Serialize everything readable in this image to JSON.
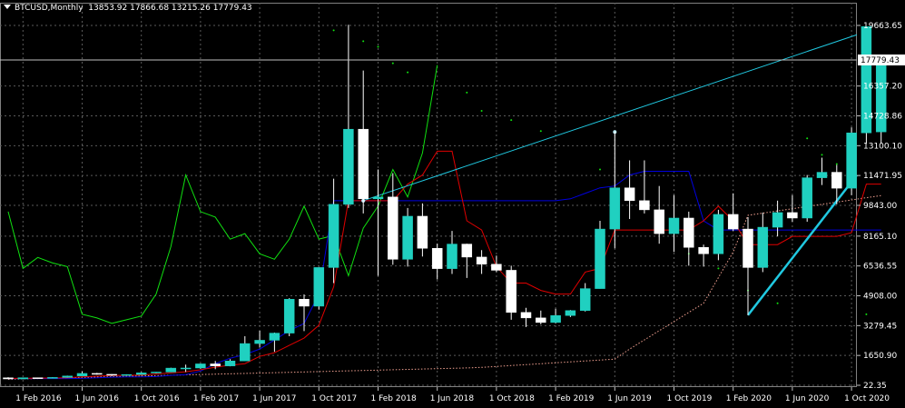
{
  "header": {
    "symbol": "BTCUSD,Monthly",
    "ohlc": "13853.92 17866.68 13215.26 17779.43"
  },
  "price_scale": {
    "labels": [
      "19663.65",
      "16357.20",
      "14728.86",
      "13100.10",
      "11471.95",
      "9843.00",
      "8165.10",
      "6536.55",
      "4908.00",
      "3279.45",
      "1650.90",
      "22.35"
    ],
    "current_price_label": "17779.43"
  },
  "time_scale": {
    "labels": [
      "1 Feb 2016",
      "1 Jun 2016",
      "1 Oct 2016",
      "1 Feb 2017",
      "1 Jun 2017",
      "1 Oct 2017",
      "1 Feb 2018",
      "1 Jun 2018",
      "1 Oct 2018",
      "1 Feb 2019",
      "1 Jun 2019",
      "1 Oct 2019",
      "1 Feb 2020",
      "1 Jun 2020",
      "1 Oct 2020"
    ]
  },
  "colors": {
    "background": "#000000",
    "grid": "#5a5a5a",
    "bull": "#20d0c0",
    "bear": "#ffffff",
    "wick": "#ffffff",
    "ma_red": "#e00000",
    "ma_blue": "#0000e0",
    "chikou_green": "#10e010",
    "dots": "#10e010",
    "trend": "#20c8e0",
    "cloud_dash": "#f0a090"
  },
  "chart_data": {
    "type": "candlestick",
    "timeframe": "Monthly",
    "ylim": [
      22.35,
      21000
    ],
    "candles": [
      {
        "x": "2016-01",
        "o": 430,
        "h": 460,
        "l": 360,
        "c": 370
      },
      {
        "x": "2016-02",
        "o": 370,
        "h": 440,
        "l": 355,
        "c": 435
      },
      {
        "x": "2016-03",
        "o": 435,
        "h": 440,
        "l": 400,
        "c": 415
      },
      {
        "x": "2016-04",
        "o": 415,
        "h": 470,
        "l": 410,
        "c": 450
      },
      {
        "x": "2016-05",
        "o": 450,
        "h": 550,
        "l": 440,
        "c": 530
      },
      {
        "x": "2016-06",
        "o": 530,
        "h": 780,
        "l": 520,
        "c": 670
      },
      {
        "x": "2016-07",
        "o": 670,
        "h": 700,
        "l": 600,
        "c": 620
      },
      {
        "x": "2016-08",
        "o": 620,
        "h": 630,
        "l": 530,
        "c": 575
      },
      {
        "x": "2016-09",
        "o": 575,
        "h": 620,
        "l": 590,
        "c": 610
      },
      {
        "x": "2016-10",
        "o": 610,
        "h": 740,
        "l": 600,
        "c": 700
      },
      {
        "x": "2016-11",
        "o": 700,
        "h": 750,
        "l": 680,
        "c": 745
      },
      {
        "x": "2016-12",
        "o": 745,
        "h": 980,
        "l": 740,
        "c": 960
      },
      {
        "x": "2017-01",
        "o": 960,
        "h": 1150,
        "l": 750,
        "c": 965
      },
      {
        "x": "2017-02",
        "o": 965,
        "h": 1210,
        "l": 920,
        "c": 1190
      },
      {
        "x": "2017-03",
        "o": 1190,
        "h": 1350,
        "l": 900,
        "c": 1080
      },
      {
        "x": "2017-04",
        "o": 1080,
        "h": 1450,
        "l": 1060,
        "c": 1350
      },
      {
        "x": "2017-05",
        "o": 1350,
        "h": 2700,
        "l": 1340,
        "c": 2300
      },
      {
        "x": "2017-06",
        "o": 2300,
        "h": 3000,
        "l": 2080,
        "c": 2480
      },
      {
        "x": "2017-07",
        "o": 2480,
        "h": 2900,
        "l": 1850,
        "c": 2870
      },
      {
        "x": "2017-08",
        "o": 2870,
        "h": 4780,
        "l": 2700,
        "c": 4720
      },
      {
        "x": "2017-09",
        "o": 4720,
        "h": 4980,
        "l": 2980,
        "c": 4340
      },
      {
        "x": "2017-10",
        "o": 4340,
        "h": 6450,
        "l": 4150,
        "c": 6450
      },
      {
        "x": "2017-11",
        "o": 6450,
        "h": 11300,
        "l": 5600,
        "c": 9900
      },
      {
        "x": "2017-12",
        "o": 9900,
        "h": 19700,
        "l": 9700,
        "c": 14000
      },
      {
        "x": "2018-01",
        "o": 14000,
        "h": 17200,
        "l": 9400,
        "c": 10200
      },
      {
        "x": "2018-02",
        "o": 10200,
        "h": 11800,
        "l": 6000,
        "c": 10300
      },
      {
        "x": "2018-03",
        "o": 10300,
        "h": 11600,
        "l": 6600,
        "c": 6900
      },
      {
        "x": "2018-04",
        "o": 6900,
        "h": 9700,
        "l": 6500,
        "c": 9250
      },
      {
        "x": "2018-05",
        "o": 9250,
        "h": 9950,
        "l": 7050,
        "c": 7500
      },
      {
        "x": "2018-06",
        "o": 7500,
        "h": 7750,
        "l": 5800,
        "c": 6390
      },
      {
        "x": "2018-07",
        "o": 6390,
        "h": 8450,
        "l": 6100,
        "c": 7730
      },
      {
        "x": "2018-08",
        "o": 7730,
        "h": 7750,
        "l": 5880,
        "c": 7020
      },
      {
        "x": "2018-09",
        "o": 7020,
        "h": 7400,
        "l": 6100,
        "c": 6630
      },
      {
        "x": "2018-10",
        "o": 6630,
        "h": 7100,
        "l": 6200,
        "c": 6300
      },
      {
        "x": "2018-11",
        "o": 6300,
        "h": 6550,
        "l": 3600,
        "c": 4000
      },
      {
        "x": "2018-12",
        "o": 4000,
        "h": 4250,
        "l": 3200,
        "c": 3700
      },
      {
        "x": "2019-01",
        "o": 3700,
        "h": 4100,
        "l": 3350,
        "c": 3450
      },
      {
        "x": "2019-02",
        "o": 3450,
        "h": 4200,
        "l": 3400,
        "c": 3830
      },
      {
        "x": "2019-03",
        "o": 3830,
        "h": 4130,
        "l": 3750,
        "c": 4100
      },
      {
        "x": "2019-04",
        "o": 4100,
        "h": 5600,
        "l": 4050,
        "c": 5300
      },
      {
        "x": "2019-05",
        "o": 5300,
        "h": 9000,
        "l": 5300,
        "c": 8550
      },
      {
        "x": "2019-06",
        "o": 8550,
        "h": 13850,
        "l": 7500,
        "c": 10800
      },
      {
        "x": "2019-07",
        "o": 10800,
        "h": 12300,
        "l": 9100,
        "c": 10100
      },
      {
        "x": "2019-08",
        "o": 10100,
        "h": 12300,
        "l": 9400,
        "c": 9600
      },
      {
        "x": "2019-09",
        "o": 9600,
        "h": 10900,
        "l": 7750,
        "c": 8300
      },
      {
        "x": "2019-10",
        "o": 8300,
        "h": 10400,
        "l": 7300,
        "c": 9150
      },
      {
        "x": "2019-11",
        "o": 9150,
        "h": 9500,
        "l": 6550,
        "c": 7550
      },
      {
        "x": "2019-12",
        "o": 7550,
        "h": 7700,
        "l": 6500,
        "c": 7200
      },
      {
        "x": "2020-01",
        "o": 7200,
        "h": 9600,
        "l": 6850,
        "c": 9350
      },
      {
        "x": "2020-02",
        "o": 9350,
        "h": 10500,
        "l": 8450,
        "c": 8550
      },
      {
        "x": "2020-03",
        "o": 8550,
        "h": 9200,
        "l": 3850,
        "c": 6450
      },
      {
        "x": "2020-04",
        "o": 6450,
        "h": 9450,
        "l": 6200,
        "c": 8650
      },
      {
        "x": "2020-05",
        "o": 8650,
        "h": 10100,
        "l": 8150,
        "c": 9450
      },
      {
        "x": "2020-06",
        "o": 9450,
        "h": 10400,
        "l": 8950,
        "c": 9150
      },
      {
        "x": "2020-07",
        "o": 9150,
        "h": 11500,
        "l": 8950,
        "c": 11350
      },
      {
        "x": "2020-08",
        "o": 11350,
        "h": 12450,
        "l": 10950,
        "c": 11650
      },
      {
        "x": "2020-09",
        "o": 11650,
        "h": 12050,
        "l": 9900,
        "c": 10780
      },
      {
        "x": "2020-10",
        "o": 10780,
        "h": 14100,
        "l": 10400,
        "c": 13800
      },
      {
        "x": "2020-11",
        "o": 13800,
        "h": 19500,
        "l": 13200,
        "c": 19600
      },
      {
        "x": "2020-12",
        "o": 13853.92,
        "h": 17866.68,
        "l": 13215.26,
        "c": 17779.43
      }
    ],
    "indicators": {
      "red_line": [
        400,
        400,
        410,
        420,
        430,
        480,
        520,
        560,
        560,
        580,
        640,
        700,
        760,
        870,
        1010,
        1120,
        1200,
        1600,
        1800,
        2200,
        2600,
        3300,
        5400,
        10100,
        10100,
        10100,
        10100,
        11000,
        11500,
        12800,
        12800,
        9000,
        8500,
        6500,
        5600,
        5600,
        5200,
        5000,
        5000,
        6200,
        6400,
        8500,
        8500,
        8500,
        8500,
        8500,
        8500,
        9000,
        9800,
        9000,
        7700,
        7700,
        7700,
        8150,
        8150,
        8150,
        8150,
        8350,
        11000,
        11000
      ],
      "blue_line": [
        390,
        390,
        390,
        390,
        390,
        400,
        430,
        460,
        480,
        480,
        500,
        560,
        600,
        800,
        1200,
        1500,
        1700,
        2000,
        2500,
        3000,
        3400,
        5000,
        10100,
        10100,
        10100,
        10100,
        10100,
        10100,
        10100,
        10100,
        10100,
        10100,
        10100,
        10100,
        10100,
        10100,
        10100,
        10100,
        10200,
        10500,
        10800,
        10900,
        11500,
        11700,
        11700,
        11700,
        11700,
        9000,
        8500,
        8500,
        8500,
        8500,
        8500,
        8500,
        8500,
        8500,
        8500,
        8500,
        8500,
        8500
      ],
      "green_line": [
        9500,
        6400,
        7000,
        6700,
        6500,
        3900,
        3700,
        3400,
        3600,
        3800,
        5000,
        7600,
        11500,
        9500,
        9200,
        8000,
        8300,
        7200,
        6900,
        8000,
        9800,
        8000,
        8200,
        6000,
        8600,
        9800,
        11800,
        10300,
        12700,
        17500
      ]
    },
    "trendlines": [
      {
        "from": {
          "x": "2018-01",
          "y": 10100
        },
        "to": {
          "x": "2020-12",
          "y": 19600
        }
      },
      {
        "from": {
          "x": "2020-03",
          "y": 3850
        },
        "to": {
          "x": "2020-12",
          "y": 13200
        }
      }
    ]
  }
}
